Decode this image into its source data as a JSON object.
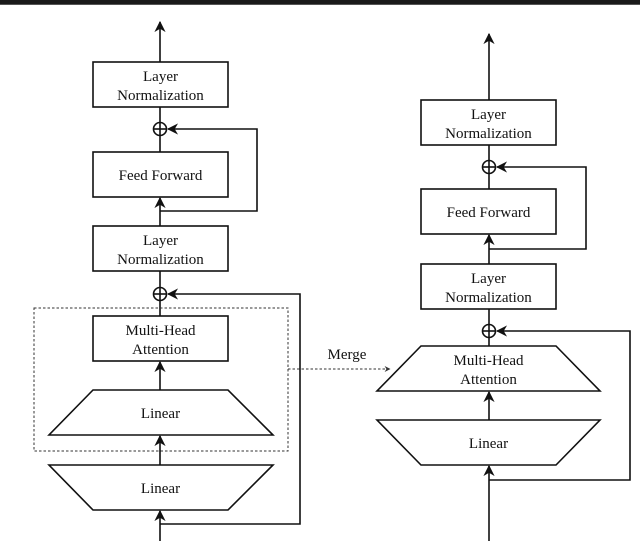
{
  "diagram": {
    "left_column": {
      "blocks": [
        {
          "id": "ln_top",
          "label_lines": [
            "Layer",
            "Normalization"
          ],
          "shape": "rectangle"
        },
        {
          "id": "ff",
          "label_lines": [
            "Feed Forward"
          ],
          "shape": "rectangle"
        },
        {
          "id": "ln_mid",
          "label_lines": [
            "Layer",
            "Normalization"
          ],
          "shape": "rectangle"
        },
        {
          "id": "mha",
          "label_lines": [
            "Multi-Head",
            "Attention"
          ],
          "shape": "rectangle"
        },
        {
          "id": "linear_upper",
          "label_lines": [
            "Linear"
          ],
          "shape": "trapezoid-wide-bottom"
        },
        {
          "id": "linear_lower",
          "label_lines": [
            "Linear"
          ],
          "shape": "trapezoid-wide-top"
        }
      ],
      "add_nodes": 2,
      "grouped_blocks": [
        "mha",
        "linear_upper"
      ]
    },
    "right_column": {
      "blocks": [
        {
          "id": "ln_top",
          "label_lines": [
            "Layer",
            "Normalization"
          ],
          "shape": "rectangle"
        },
        {
          "id": "ff",
          "label_lines": [
            "Feed Forward"
          ],
          "shape": "rectangle"
        },
        {
          "id": "ln_mid",
          "label_lines": [
            "Layer",
            "Normalization"
          ],
          "shape": "rectangle"
        },
        {
          "id": "mha_merged",
          "label_lines": [
            "Multi-Head",
            "Attention"
          ],
          "shape": "trapezoid-wide-bottom"
        },
        {
          "id": "linear",
          "label_lines": [
            "Linear"
          ],
          "shape": "trapezoid-wide-top"
        }
      ],
      "add_nodes": 2
    },
    "merge_label": "Merge",
    "add_symbol": "⊕"
  }
}
